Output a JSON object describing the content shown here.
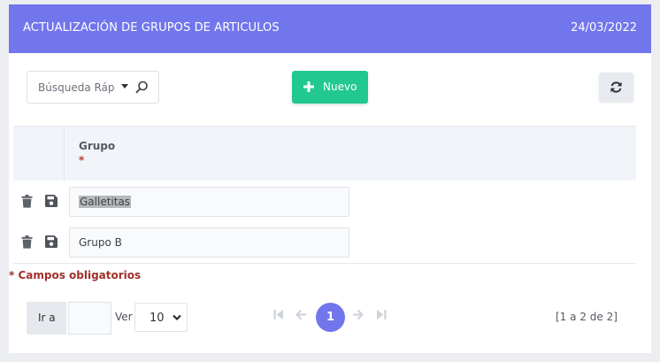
{
  "header": {
    "title": "ACTUALIZACIÓN DE GRUPOS DE ARTICULOS",
    "date": "24/03/2022",
    "color": "#7276ec"
  },
  "toolbar": {
    "search_placeholder": "Búsqueda Ráp",
    "new_label": "Nuevo",
    "new_color": "#21c88f"
  },
  "grid": {
    "columns": [
      {
        "label": "Grupo",
        "required_mark": "*"
      }
    ],
    "rows": [
      {
        "grupo": "Galletitas"
      },
      {
        "grupo": "Grupo B"
      }
    ]
  },
  "required_note": "* Campos obligatorios",
  "pagination": {
    "goto_label": "Ir a",
    "goto_value": "",
    "per_page_label": "Ver",
    "per_page_value": "10",
    "current_page": "1",
    "range_text": "[1 a 2 de 2]"
  }
}
